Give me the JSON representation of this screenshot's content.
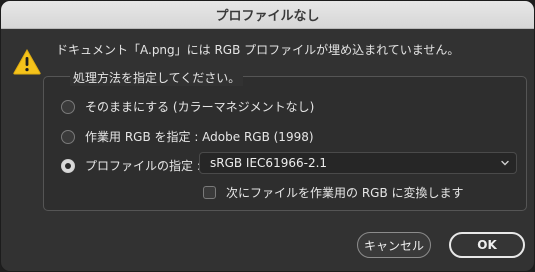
{
  "window": {
    "title": "プロファイルなし"
  },
  "message": {
    "text": "ドキュメント「A.png」には RGB プロファイルが埋め込まれていません。",
    "icon": "warning-triangle-icon"
  },
  "group": {
    "legend": "処理方法を指定してください。"
  },
  "options": [
    {
      "label": "そのままにする (カラーマネジメントなし)",
      "checked": false
    },
    {
      "label": "作業用 RGB を指定 : Adobe RGB (1998)",
      "checked": false
    },
    {
      "label": "プロファイルの指定 :",
      "checked": true
    }
  ],
  "profile_select": {
    "value": "sRGB IEC61966-2.1"
  },
  "convert_checkbox": {
    "label": "次にファイルを作業用の RGB に変換します",
    "checked": false
  },
  "buttons": {
    "cancel": "キャンセル",
    "ok": "OK"
  },
  "colors": {
    "warning": "#f5c31b",
    "background": "#323232"
  }
}
